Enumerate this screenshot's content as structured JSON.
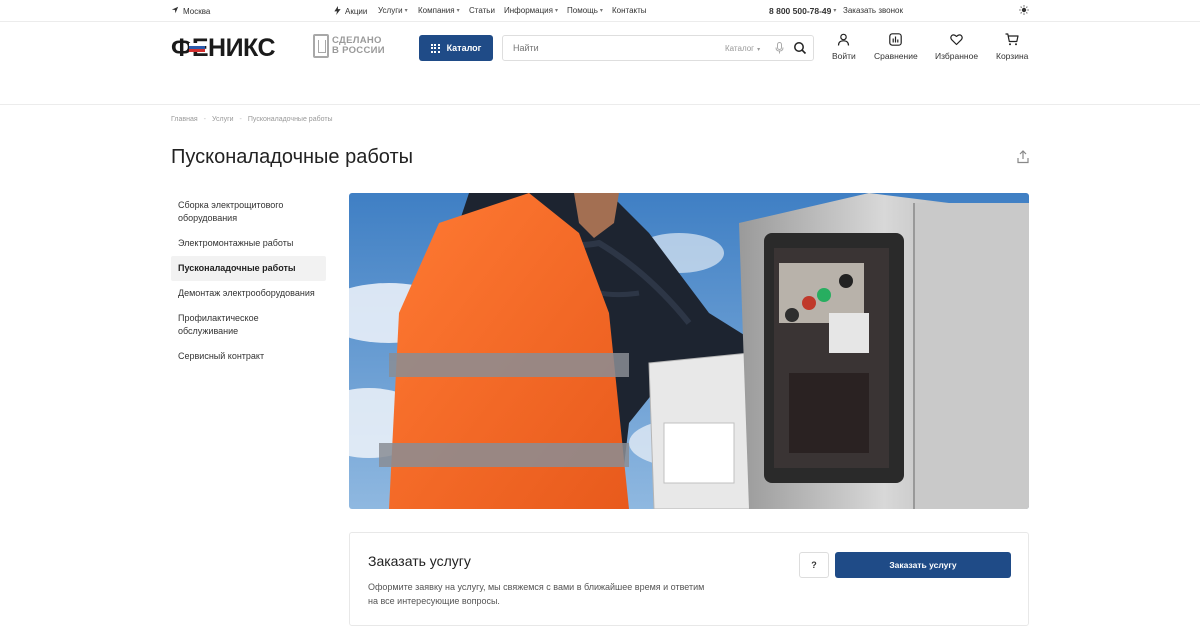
{
  "topbar": {
    "city": "Москва",
    "nav": [
      {
        "label": "Акции",
        "dropdown": false,
        "icon": "lightning-icon"
      },
      {
        "label": "Услуги",
        "dropdown": true
      },
      {
        "label": "Компания",
        "dropdown": true
      },
      {
        "label": "Статьи",
        "dropdown": false
      },
      {
        "label": "Информация",
        "dropdown": true
      },
      {
        "label": "Помощь",
        "dropdown": true
      },
      {
        "label": "Контакты",
        "dropdown": false
      }
    ],
    "phone": "8 800 500-78-49",
    "callback": "Заказать звонок"
  },
  "header": {
    "logo_text": "ФЕНИКС",
    "made_in_russia": [
      "СДЕЛАНО",
      "В РОССИИ"
    ],
    "catalog_button": "Каталог",
    "search": {
      "placeholder": "Найти",
      "category": "Каталог"
    },
    "actions": [
      {
        "label": "Войти",
        "icon": "user-icon"
      },
      {
        "label": "Сравнение",
        "icon": "compare-icon"
      },
      {
        "label": "Избранное",
        "icon": "heart-icon"
      },
      {
        "label": "Корзина",
        "icon": "cart-icon"
      }
    ]
  },
  "breadcrumb": [
    "Главная",
    "Услуги",
    "Пусконаладочные работы"
  ],
  "page_title": "Пусконаладочные работы",
  "sidebar": {
    "items": [
      {
        "label": "Сборка электрощитового оборудования",
        "active": false
      },
      {
        "label": "Электромонтажные работы",
        "active": false
      },
      {
        "label": "Пусконаладочные работы",
        "active": true
      },
      {
        "label": "Демонтаж электрооборудования",
        "active": false
      },
      {
        "label": "Профилактическое обслуживание",
        "active": false
      },
      {
        "label": "Сервисный контракт",
        "active": false
      }
    ]
  },
  "order_card": {
    "title": "Заказать услугу",
    "description": "Оформите заявку на услугу, мы свяжемся с вами в ближайшее время и ответим на все интересующие вопросы.",
    "question_button": "?",
    "order_button": "Заказать услугу"
  },
  "colors": {
    "accent": "#1f4b87",
    "vest": "#f26b2a",
    "sky": "#4a86c8"
  }
}
